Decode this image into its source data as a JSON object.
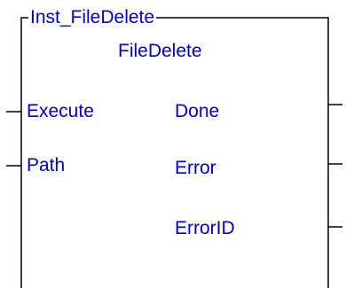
{
  "block": {
    "instance_name": "Inst_FileDelete",
    "type_name": "FileDelete",
    "inputs": [
      {
        "label": "Execute"
      },
      {
        "label": "Path"
      }
    ],
    "outputs": [
      {
        "label": "Done"
      },
      {
        "label": "Error"
      },
      {
        "label": "ErrorID"
      }
    ],
    "colors": {
      "text": "#0000c8",
      "line": "#000000",
      "background": "#ffffff"
    }
  }
}
